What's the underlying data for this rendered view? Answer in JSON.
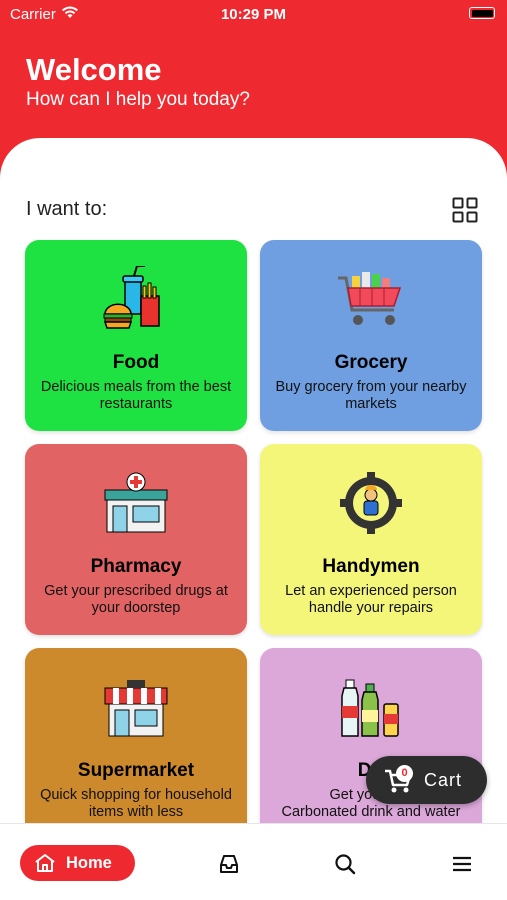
{
  "status_bar": {
    "carrier": "Carrier",
    "time": "10:29 PM"
  },
  "header": {
    "title": "Welcome",
    "subtitle": "How can I help you today?",
    "color": "#ee2a30"
  },
  "section": {
    "title": "I want to:",
    "view_toggle_icon": "grid-icon"
  },
  "categories": [
    {
      "title": "Food",
      "description": "Delicious meals from the best restaurants",
      "color": "#1de241",
      "icon": "fast-food-icon"
    },
    {
      "title": "Grocery",
      "description": "Buy grocery from your nearby markets",
      "color": "#6f9fe0",
      "icon": "shopping-cart-icon"
    },
    {
      "title": "Pharmacy",
      "description": "Get your prescribed drugs at your doorstep",
      "color": "#e26363",
      "icon": "pharmacy-store-icon"
    },
    {
      "title": "Handymen",
      "description": "Let an experienced person handle your repairs",
      "color": "#f4f67a",
      "icon": "handyman-gear-icon"
    },
    {
      "title": "Supermarket",
      "description": "Quick shopping for household items with less",
      "color": "#cd8a2c",
      "icon": "shop-icon"
    },
    {
      "title": "Dri",
      "description": "Get your Ass",
      "description_tail": "Carbonated drink and water",
      "color": "#dca8d9",
      "icon": "bottles-icon"
    }
  ],
  "cart": {
    "label": "Cart",
    "count": "0",
    "icon": "cart-icon"
  },
  "bottom_nav": {
    "home_label": "Home",
    "items": [
      "home-icon",
      "inbox-icon",
      "search-icon",
      "menu-icon"
    ]
  }
}
